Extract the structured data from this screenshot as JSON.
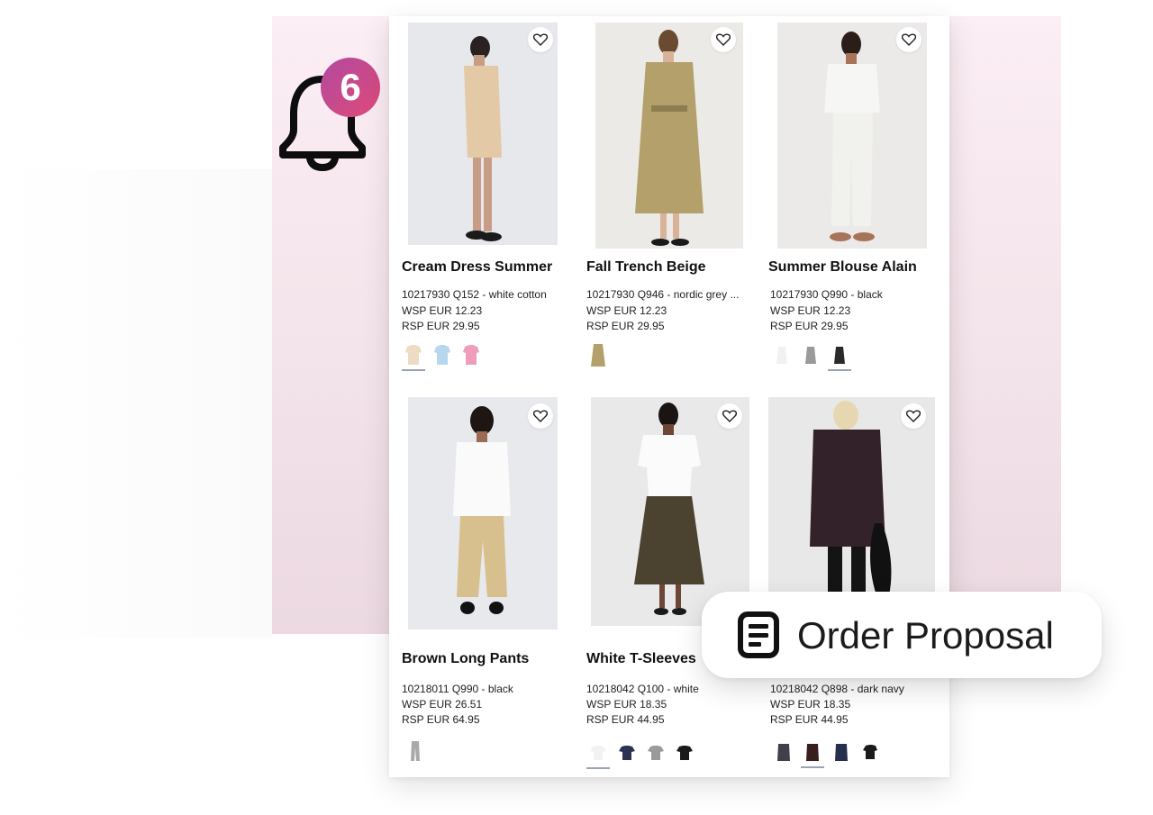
{
  "notifications": {
    "count": "6",
    "icon": "bell-icon"
  },
  "products": [
    {
      "name": "Cream Dress Summer",
      "sku": "10217930 Q152 - white cotton",
      "wsp": "WSP EUR 12.23",
      "rsp": "RSP EUR 29.95"
    },
    {
      "name": "Fall Trench Beige",
      "sku": "10217930 Q946 - nordic grey ...",
      "wsp": "WSP EUR 12.23",
      "rsp": "RSP EUR 29.95"
    },
    {
      "name": "Summer Blouse Alain",
      "sku": "10217930 Q990 - black",
      "wsp": "WSP EUR 12.23",
      "rsp": "RSP EUR 29.95"
    },
    {
      "name": "Brown Long Pants",
      "sku": "10218011 Q990 - black",
      "wsp": "WSP EUR 26.51",
      "rsp": "RSP EUR 64.95"
    },
    {
      "name": "White T-Sleeves",
      "sku": "10218042 Q100 - white",
      "wsp": "WSP EUR 18.35",
      "rsp": "RSP EUR 44.95"
    },
    {
      "name": "",
      "sku": "10218042 Q898 - dark navy",
      "wsp": "WSP EUR 18.35",
      "rsp": "RSP EUR 44.95"
    }
  ],
  "order_proposal": {
    "label": "Order Proposal",
    "icon": "document-icon"
  },
  "colors": {
    "badge_start": "#b04aa0",
    "badge_end": "#e04a78",
    "panel": "#f3e3ea"
  }
}
